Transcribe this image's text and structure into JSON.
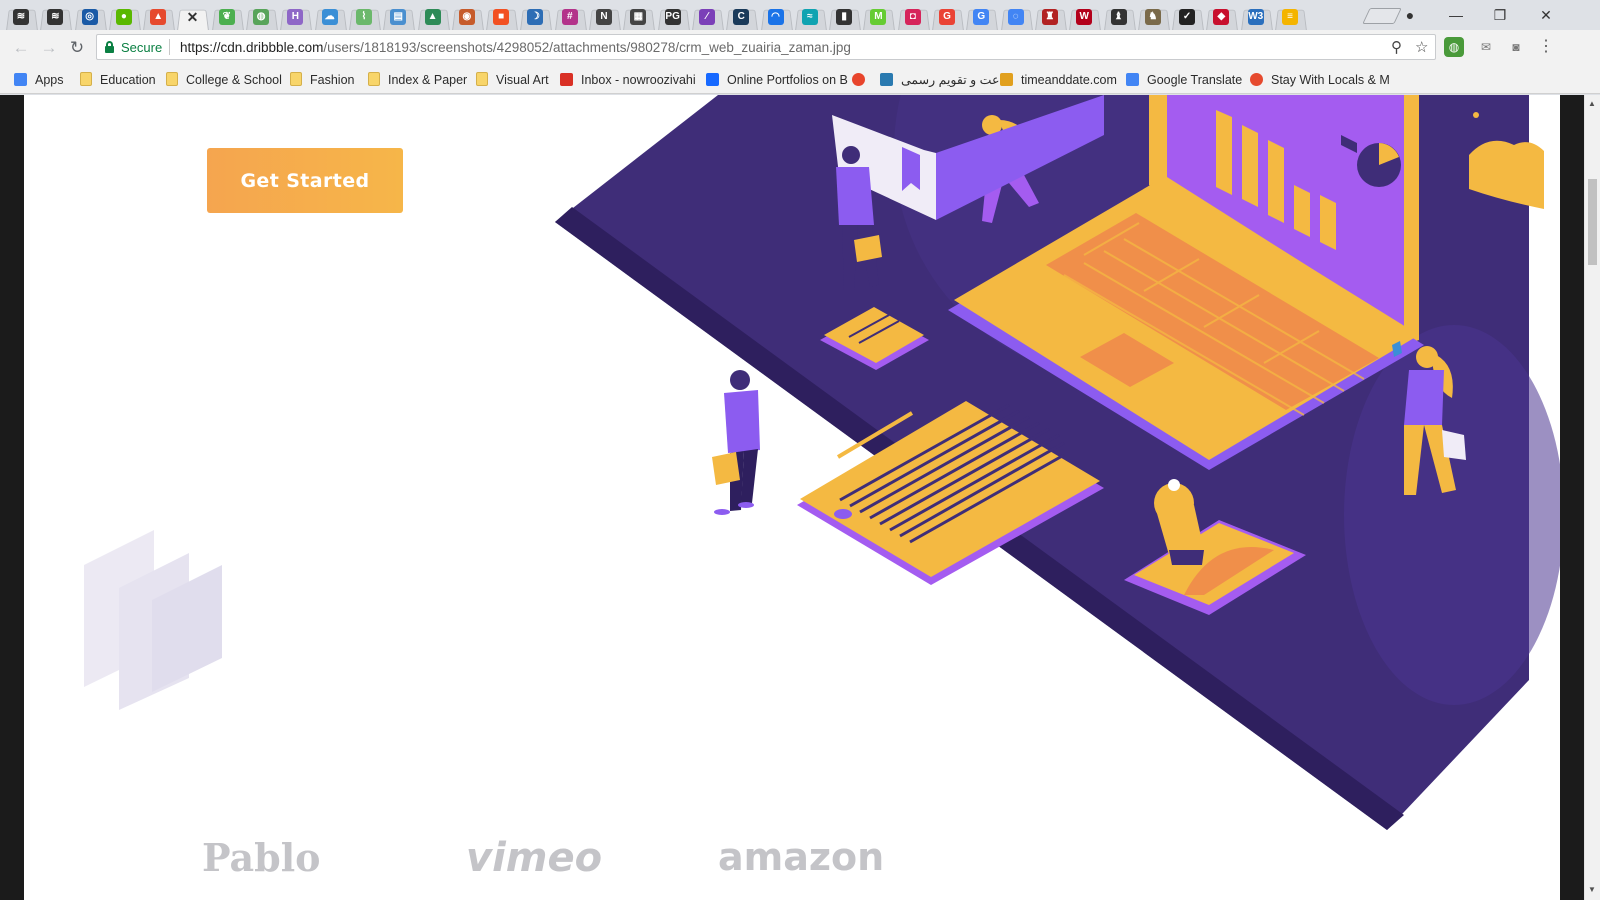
{
  "browser": {
    "tabs": [
      {
        "icon": "stack-icon",
        "color": "#333333",
        "glyph": "≋"
      },
      {
        "icon": "stack-icon",
        "color": "#333333",
        "glyph": "≋"
      },
      {
        "icon": "shield-icon",
        "color": "#1a5aa6",
        "glyph": "◎"
      },
      {
        "icon": "messenger-icon",
        "color": "#5ab800",
        "glyph": "●"
      },
      {
        "icon": "drive-icon",
        "color": "#e64a2e",
        "glyph": "▲"
      },
      {
        "icon": "close-icon",
        "color": "#333333",
        "glyph": "✕",
        "active": true
      },
      {
        "icon": "leaf-icon",
        "color": "#4caf50",
        "glyph": "❦"
      },
      {
        "icon": "globe-icon",
        "color": "#58a45a",
        "glyph": "◍"
      },
      {
        "icon": "h-icon",
        "color": "#8e67c7",
        "glyph": "H"
      },
      {
        "icon": "cloud-icon",
        "color": "#3b8fd6",
        "glyph": "☁"
      },
      {
        "icon": "chart-icon",
        "color": "#6bb86b",
        "glyph": "⌇"
      },
      {
        "icon": "doc-icon",
        "color": "#4a8fcf",
        "glyph": "▤"
      },
      {
        "icon": "tree-icon",
        "color": "#2e8b57",
        "glyph": "▲"
      },
      {
        "icon": "fox-icon",
        "color": "#c65b2b",
        "glyph": "◉"
      },
      {
        "icon": "windows-icon",
        "color": "#f25022",
        "glyph": "■"
      },
      {
        "icon": "crescent-icon",
        "color": "#2d6db5",
        "glyph": "☽"
      },
      {
        "icon": "slack-icon",
        "color": "#b3338a",
        "glyph": "#"
      },
      {
        "icon": "n-icon",
        "color": "#444444",
        "glyph": "N"
      },
      {
        "icon": "grid-icon",
        "color": "#444444",
        "glyph": "▦"
      },
      {
        "icon": "pg-icon",
        "color": "#333333",
        "glyph": "PG"
      },
      {
        "icon": "pen-icon",
        "color": "#7b3fb8",
        "glyph": "∕"
      },
      {
        "icon": "c-icon",
        "color": "#1a3a5a",
        "glyph": "C"
      },
      {
        "icon": "arc-icon",
        "color": "#1a73e8",
        "glyph": "◠"
      },
      {
        "icon": "wave-icon",
        "color": "#0fa3b1",
        "glyph": "≈"
      },
      {
        "icon": "bookmark-icon",
        "color": "#333333",
        "glyph": "▮"
      },
      {
        "icon": "m-icon",
        "color": "#66cc33",
        "glyph": "M"
      },
      {
        "icon": "chat-icon",
        "color": "#d6245b",
        "glyph": "◘"
      },
      {
        "icon": "google-icon",
        "color": "#ea4335",
        "glyph": "G"
      },
      {
        "icon": "google-icon",
        "color": "#4285f4",
        "glyph": "G"
      },
      {
        "icon": "loading-icon",
        "color": "#4285f4",
        "glyph": "◌"
      },
      {
        "icon": "crest-icon",
        "color": "#b22222",
        "glyph": "♜"
      },
      {
        "icon": "w-icon",
        "color": "#b3001b",
        "glyph": "W"
      },
      {
        "icon": "crest-icon",
        "color": "#333333",
        "glyph": "♝"
      },
      {
        "icon": "crest-icon",
        "color": "#7a6a4a",
        "glyph": "♞"
      },
      {
        "icon": "bird-icon",
        "color": "#222222",
        "glyph": "✓"
      },
      {
        "icon": "shield-icon",
        "color": "#c8102e",
        "glyph": "◆"
      },
      {
        "icon": "w3-icon",
        "color": "#2a6fbd",
        "glyph": "W3"
      },
      {
        "icon": "note-icon",
        "color": "#f4b400",
        "glyph": "≡"
      }
    ],
    "window_controls": {
      "profile": "●",
      "minimize": "—",
      "restore": "❐",
      "close": "✕"
    },
    "security_label": "Secure",
    "url_host": "https://cdn.dribbble.com",
    "url_path": "/users/1818193/screenshots/4298052/attachments/980278/crm_web_zuairia_zaman.jpg",
    "bookmarks": [
      {
        "label": "Apps",
        "icon": "apps-icon"
      },
      {
        "label": "Education",
        "icon": "folder-icon"
      },
      {
        "label": "College & School",
        "icon": "folder-icon"
      },
      {
        "label": "Fashion",
        "icon": "folder-icon"
      },
      {
        "label": "Index & Paper",
        "icon": "folder-icon"
      },
      {
        "label": "Visual Art",
        "icon": "folder-icon"
      },
      {
        "label": "Inbox - nowroozivahi",
        "icon": "gmail-icon"
      },
      {
        "label": "Online Portfolios on B",
        "icon": "behance-icon"
      },
      {
        "label": "",
        "icon": "t-icon"
      },
      {
        "label": "ساعت و تقویم رسمی",
        "icon": "calendar-icon"
      },
      {
        "label": "timeanddate.com",
        "icon": "sparkle-icon"
      },
      {
        "label": "Google Translate",
        "icon": "translate-icon"
      },
      {
        "label": "Stay With Locals & M",
        "icon": "couchsurfing-icon"
      }
    ]
  },
  "page": {
    "cta_label": "Get Started",
    "brands": [
      "Pablo",
      "vimeo",
      "amazon"
    ]
  },
  "colors": {
    "accent_orange": "#f5a54f",
    "platform_purple": "#3f2d78",
    "illustration_yellow": "#f4b942",
    "illustration_violet": "#8c5cf0"
  }
}
